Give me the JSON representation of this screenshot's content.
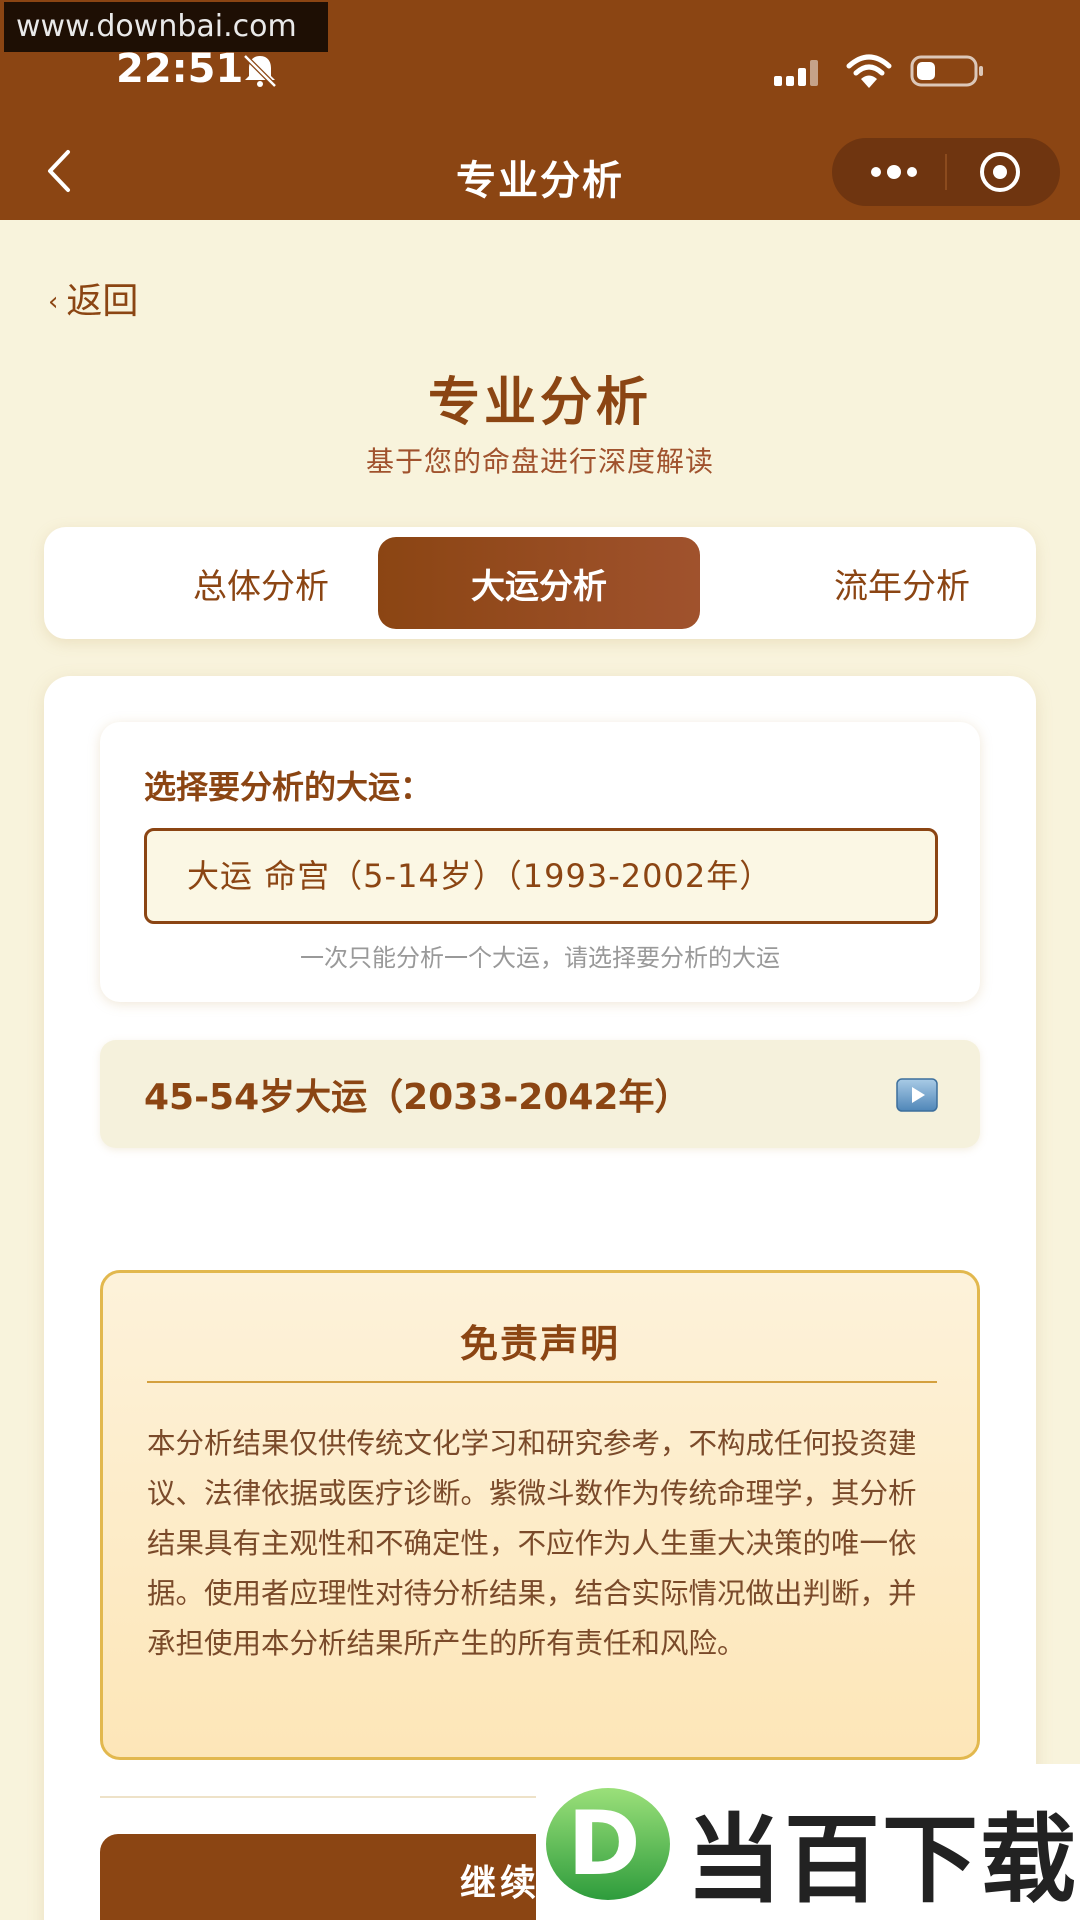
{
  "watermark_top": "www.downbai.com",
  "status_bar": {
    "time": "22:51"
  },
  "nav": {
    "title": "专业分析"
  },
  "back_link": {
    "label": "返回",
    "chevron": "‹"
  },
  "header": {
    "title": "专业分析",
    "subtitle": "基于您的命盘进行深度解读"
  },
  "tabs": [
    {
      "label": "总体分析",
      "active": false
    },
    {
      "label": "大运分析",
      "active": true
    },
    {
      "label": "流年分析",
      "active": false
    }
  ],
  "selector": {
    "label": "选择要分析的大运：",
    "selected_value": "大运 命宫（5-14岁）（1993-2002年）",
    "hint": "一次只能分析一个大运，请选择要分析的大运"
  },
  "dayun_item": {
    "label": "45-54岁大运（2033-2042年）",
    "icon": "play-icon"
  },
  "disclaimer": {
    "title": "免责声明",
    "text": "本分析结果仅供传统文化学习和研究参考，不构成任何投资建议、法律依据或医疗诊断。紫微斗数作为传统命理学，其分析结果具有主观性和不确定性，不应作为人生重大决策的唯一依据。使用者应理性对待分析结果，结合实际情况做出判断，并承担使用本分析结果所产生的所有责任和风险。"
  },
  "continue_button": {
    "label": "继续分析"
  },
  "watermark_logo": {
    "badge": "D",
    "text": "当百下载"
  },
  "colors": {
    "brand": "#8b4513",
    "background": "#f8f3dc",
    "disclaimer_border": "#e2b84e"
  }
}
